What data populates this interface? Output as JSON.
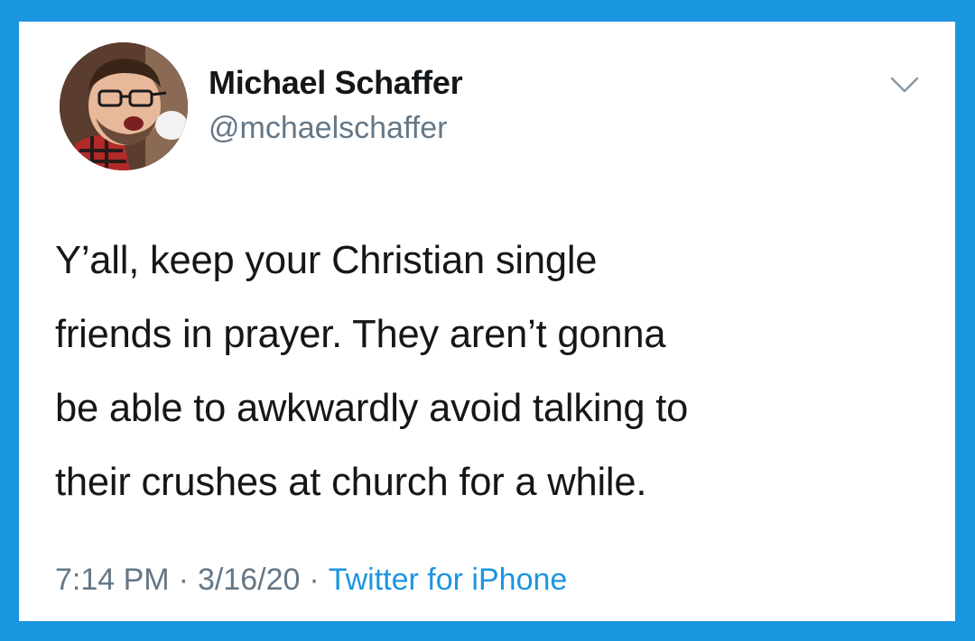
{
  "tweet": {
    "author": {
      "display_name": "Michael Schaffer",
      "handle": "@mchaelschaffer",
      "avatar_icon": "profile-photo"
    },
    "menu_icon": "chevron-down-icon",
    "text": "Y’all, keep your Christian single\nfriends in prayer. They aren’t gonna\nbe able to awkwardly avoid talking to\ntheir crushes at church for a while.",
    "time": "7:14 PM",
    "date": "3/16/20",
    "separator": "·",
    "source": "Twitter for iPhone"
  },
  "colors": {
    "frame": "#1a95e0",
    "card": "#ffffff",
    "text_primary": "#14171a",
    "text_secondary": "#657786",
    "link": "#1b95e0"
  }
}
